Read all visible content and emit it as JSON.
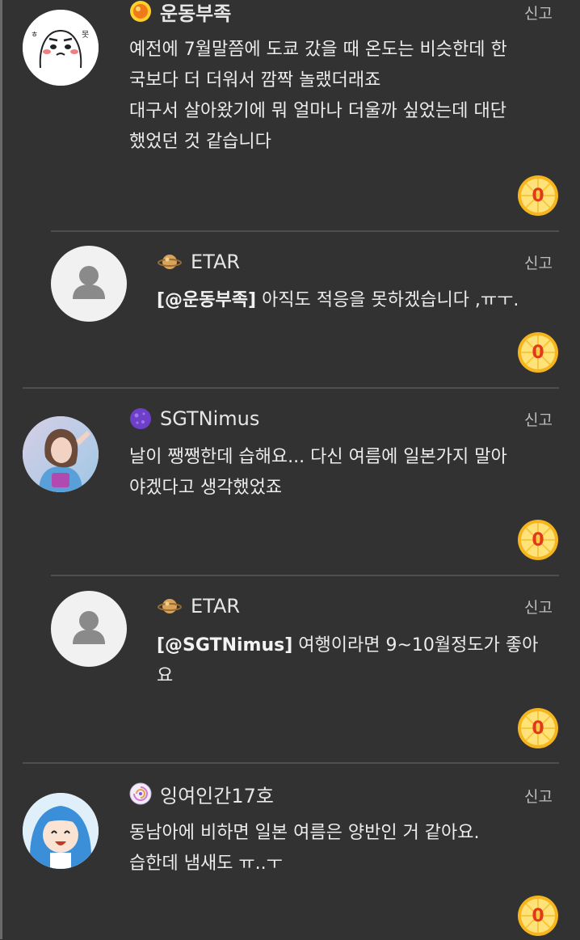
{
  "report_label": "신고",
  "comments": [
    {
      "author": "운동부족",
      "level_icon": "sun-level-icon",
      "lines": [
        "예전에 7월말쯤에 도쿄 갔을 때 온도는 비슷한데 한",
        "국보다 더 더워서 깜짝 놀랬더래죠",
        "대구서 살아왔기에 뭐 얼마나 더울까 싶었는데 대단",
        "했었던 것 같습니다"
      ],
      "likes": "0",
      "avatar": "cartoon-avatar"
    },
    {
      "author": "ETAR",
      "level_icon": "saturn-level-icon",
      "mention": "[@운동부족]",
      "lines": [
        " 아직도 적응을 못하겠습니다 ,ㅠㅜ."
      ],
      "likes": "0",
      "avatar": "default-avatar"
    },
    {
      "author": "SGTNimus",
      "level_icon": "purple-planet-level-icon",
      "lines": [
        "날이 쨍쨍한데 습해요... 다신 여름에 일본가지 말아",
        "야겠다고 생각했었죠"
      ],
      "likes": "0",
      "avatar": "photo-avatar"
    },
    {
      "author": "ETAR",
      "level_icon": "saturn-level-icon",
      "mention": "[@SGTNimus]",
      "lines": [
        " 여행이라면 9~10월정도가 좋아",
        "요"
      ],
      "likes": "0",
      "avatar": "default-avatar"
    },
    {
      "author": "잉여인간17호",
      "level_icon": "galaxy-level-icon",
      "lines": [
        "동남아에 비하면 일본 여름은 양반인 거 같아요.",
        "습한데 냄새도 ㅠ..ㅜ"
      ],
      "likes": "0",
      "avatar": "anime-avatar"
    }
  ]
}
